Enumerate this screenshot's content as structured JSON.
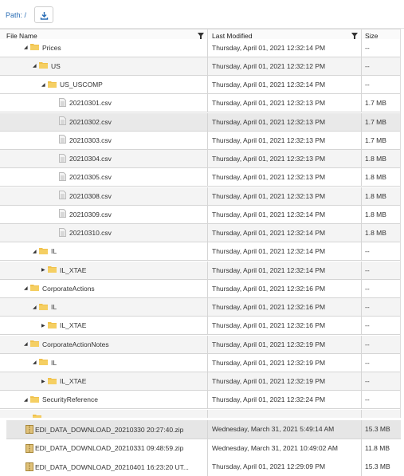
{
  "path": {
    "label": "Path: /"
  },
  "columns": {
    "name": "File Name",
    "modified": "Last Modified",
    "size": "Size"
  },
  "tree": [
    {
      "name": "Prices",
      "modified": "Thursday, April 01, 2021 12:32:14 PM",
      "size": "--",
      "type": "folder",
      "depth": 0,
      "toggle": "expanded",
      "style": "plain"
    },
    {
      "name": "US",
      "modified": "Thursday, April 01, 2021 12:32:12 PM",
      "size": "--",
      "type": "folder",
      "depth": 1,
      "toggle": "expanded",
      "style": "alt"
    },
    {
      "name": "US_USCOMP",
      "modified": "Thursday, April 01, 2021 12:32:14 PM",
      "size": "--",
      "type": "folder",
      "depth": 2,
      "toggle": "expanded",
      "style": "plain"
    },
    {
      "name": "20210301.csv",
      "modified": "Thursday, April 01, 2021 12:32:13 PM",
      "size": "1.7 MB",
      "type": "file",
      "depth": 3,
      "toggle": "none",
      "style": "plain"
    },
    {
      "name": "20210302.csv",
      "modified": "Thursday, April 01, 2021 12:32:13 PM",
      "size": "1.7 MB",
      "type": "file",
      "depth": 3,
      "toggle": "none",
      "style": "sel"
    },
    {
      "name": "20210303.csv",
      "modified": "Thursday, April 01, 2021 12:32:13 PM",
      "size": "1.7 MB",
      "type": "file",
      "depth": 3,
      "toggle": "none",
      "style": "plain"
    },
    {
      "name": "20210304.csv",
      "modified": "Thursday, April 01, 2021 12:32:13 PM",
      "size": "1.8 MB",
      "type": "file",
      "depth": 3,
      "toggle": "none",
      "style": "alt"
    },
    {
      "name": "20210305.csv",
      "modified": "Thursday, April 01, 2021 12:32:13 PM",
      "size": "1.8 MB",
      "type": "file",
      "depth": 3,
      "toggle": "none",
      "style": "plain"
    },
    {
      "name": "20210308.csv",
      "modified": "Thursday, April 01, 2021 12:32:13 PM",
      "size": "1.8 MB",
      "type": "file",
      "depth": 3,
      "toggle": "none",
      "style": "alt"
    },
    {
      "name": "20210309.csv",
      "modified": "Thursday, April 01, 2021 12:32:14 PM",
      "size": "1.8 MB",
      "type": "file",
      "depth": 3,
      "toggle": "none",
      "style": "plain"
    },
    {
      "name": "20210310.csv",
      "modified": "Thursday, April 01, 2021 12:32:14 PM",
      "size": "1.8 MB",
      "type": "file",
      "depth": 3,
      "toggle": "none",
      "style": "alt"
    },
    {
      "name": "IL",
      "modified": "Thursday, April 01, 2021 12:32:14 PM",
      "size": "--",
      "type": "folder",
      "depth": 1,
      "toggle": "expanded",
      "style": "plain"
    },
    {
      "name": "IL_XTAE",
      "modified": "Thursday, April 01, 2021 12:32:14 PM",
      "size": "--",
      "type": "folder",
      "depth": 2,
      "toggle": "collapsed",
      "style": "alt"
    },
    {
      "name": "CorporateActions",
      "modified": "Thursday, April 01, 2021 12:32:16 PM",
      "size": "--",
      "type": "folder",
      "depth": 0,
      "toggle": "expanded",
      "style": "plain"
    },
    {
      "name": "IL",
      "modified": "Thursday, April 01, 2021 12:32:16 PM",
      "size": "--",
      "type": "folder",
      "depth": 1,
      "toggle": "expanded",
      "style": "alt"
    },
    {
      "name": "IL_XTAE",
      "modified": "Thursday, April 01, 2021 12:32:16 PM",
      "size": "--",
      "type": "folder",
      "depth": 2,
      "toggle": "collapsed",
      "style": "plain"
    },
    {
      "name": "CorporateActionNotes",
      "modified": "Thursday, April 01, 2021 12:32:19 PM",
      "size": "--",
      "type": "folder",
      "depth": 0,
      "toggle": "expanded",
      "style": "alt"
    },
    {
      "name": "IL",
      "modified": "Thursday, April 01, 2021 12:32:19 PM",
      "size": "--",
      "type": "folder",
      "depth": 1,
      "toggle": "expanded",
      "style": "plain"
    },
    {
      "name": "IL_XTAE",
      "modified": "Thursday, April 01, 2021 12:32:19 PM",
      "size": "--",
      "type": "folder",
      "depth": 2,
      "toggle": "collapsed",
      "style": "alt"
    },
    {
      "name": "SecurityReference",
      "modified": "Thursday, April 01, 2021 12:32:24 PM",
      "size": "--",
      "type": "folder",
      "depth": 0,
      "toggle": "expanded",
      "style": "plain"
    },
    {
      "name": "",
      "modified": "",
      "size": "",
      "type": "folder",
      "depth": 1,
      "toggle": "none",
      "style": "alt"
    }
  ],
  "files": [
    {
      "name": "EDI_DATA_DOWNLOAD_20210330 20:27:40.zip",
      "modified": "Wednesday, March 31, 2021 5:49:14 AM",
      "size": "15.3 MB",
      "style": "sel"
    },
    {
      "name": "EDI_DATA_DOWNLOAD_20210331 09:48:59.zip",
      "modified": "Wednesday, March 31, 2021 10:49:02 AM",
      "size": "11.8 MB",
      "style": "plain"
    },
    {
      "name": "EDI_DATA_DOWNLOAD_20210401 16:23:20 UT...",
      "modified": "Thursday, April 01, 2021 12:29:09 PM",
      "size": "15.3 MB",
      "style": "plain"
    }
  ],
  "colors": {
    "accent": "#2a6db5",
    "folder": "#f0c14b",
    "zip": "#c8a34a"
  }
}
